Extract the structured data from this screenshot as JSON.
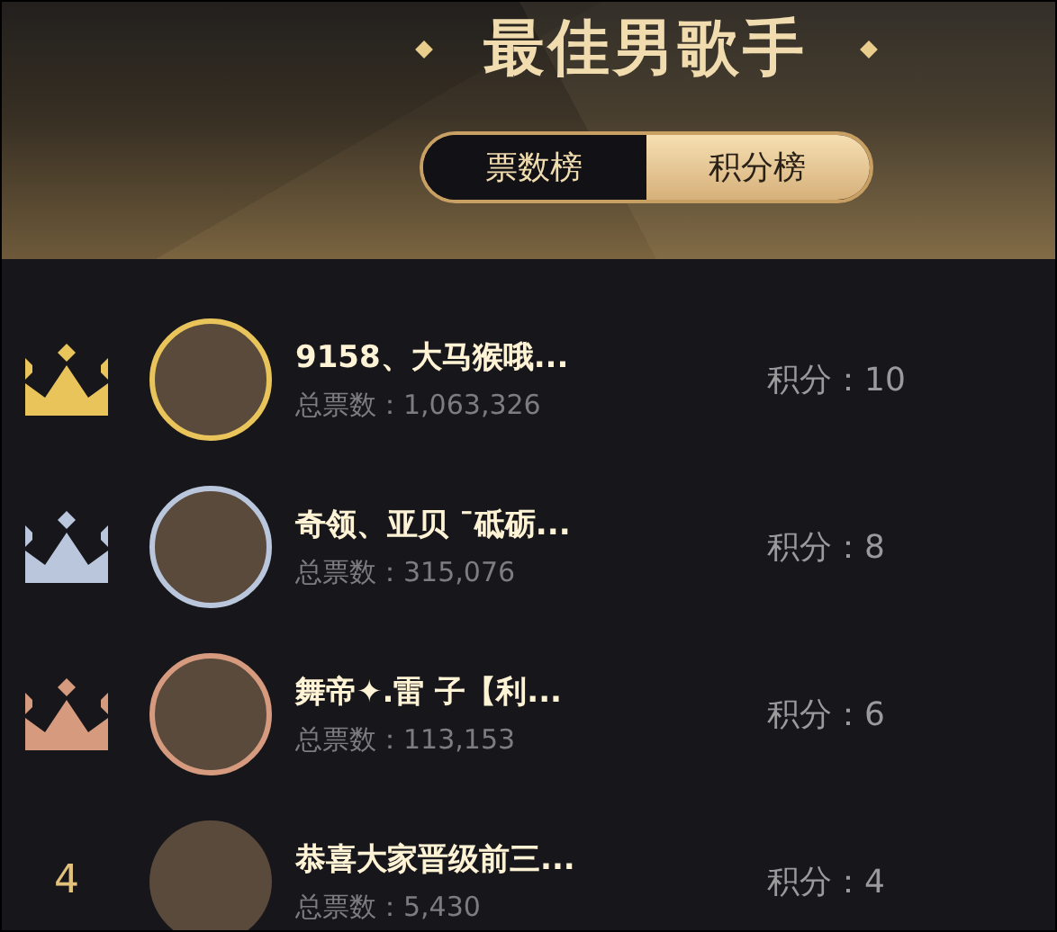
{
  "header": {
    "title": "最佳男歌手"
  },
  "tabs": [
    {
      "label": "票数榜",
      "selected": false
    },
    {
      "label": "积分榜",
      "selected": true
    }
  ],
  "rows": [
    {
      "kind": "crown",
      "color": "#e8c45a",
      "name": "9158、大马猴哦...",
      "votes": "总票数：1,063,326",
      "score": "积分：10"
    },
    {
      "kind": "crown",
      "color": "#b9c6dc",
      "name": "奇领、亚贝 ˉ砥砺...",
      "votes": "总票数：315,076",
      "score": "积分：8"
    },
    {
      "kind": "crown",
      "color": "#d69a7e",
      "name": "舞帝✦.雷 子【利...",
      "votes": "总票数：113,153",
      "score": "积分：6"
    },
    {
      "kind": "number",
      "rank": "4",
      "name": "恭喜大家晋级前三...",
      "votes": "总票数：5,430",
      "score": "积分：4"
    }
  ]
}
